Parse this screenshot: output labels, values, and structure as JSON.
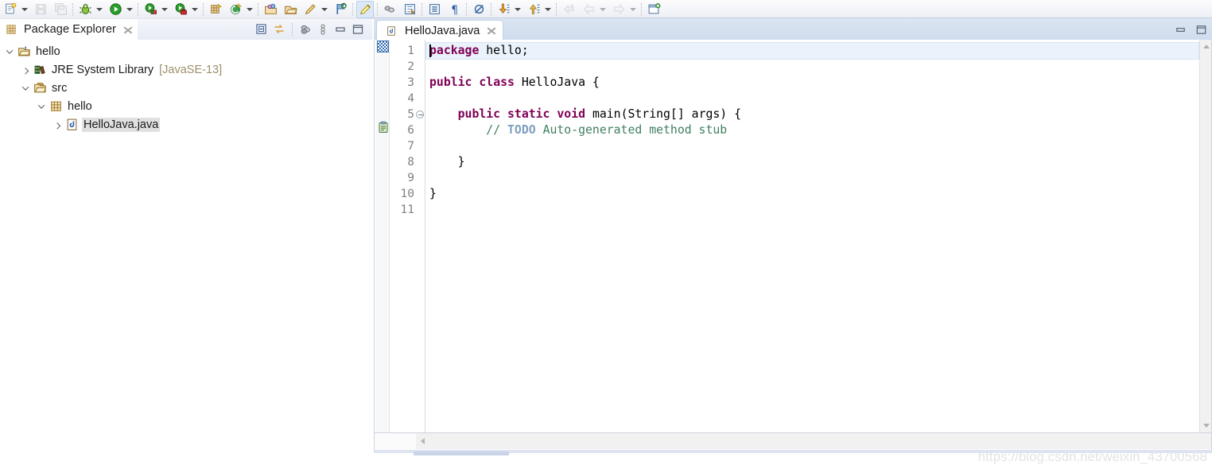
{
  "toolbar": {
    "items": [
      {
        "name": "new-wizard-button",
        "icon": "new-file-icon",
        "dropdown": true,
        "disabled": false
      },
      {
        "name": "save-button",
        "icon": "save-icon",
        "dropdown": false,
        "disabled": true
      },
      {
        "name": "save-all-button",
        "icon": "save-all-icon",
        "dropdown": false,
        "disabled": true
      },
      {
        "name": "debug-button",
        "icon": "debug-bug-icon",
        "dropdown": true,
        "disabled": false
      },
      {
        "name": "run-button",
        "icon": "run-play-icon",
        "dropdown": true,
        "disabled": false
      },
      {
        "name": "coverage-button",
        "icon": "coverage-icon",
        "dropdown": true,
        "disabled": false
      },
      {
        "name": "external-tools-button",
        "icon": "external-tools-icon",
        "dropdown": true,
        "disabled": false
      },
      {
        "name": "new-java-package-button",
        "icon": "new-package-icon",
        "dropdown": false,
        "disabled": false
      },
      {
        "name": "new-java-class-button",
        "icon": "new-class-icon",
        "dropdown": true,
        "disabled": false
      },
      {
        "name": "open-type-button",
        "icon": "open-type-icon",
        "dropdown": false,
        "disabled": false
      },
      {
        "name": "open-task-button",
        "icon": "open-folder-icon",
        "dropdown": false,
        "disabled": false
      },
      {
        "name": "edit-mode-button",
        "icon": "pencil-icon",
        "dropdown": true,
        "disabled": false
      },
      {
        "name": "search-button",
        "icon": "search-flag-icon",
        "dropdown": false,
        "disabled": false
      },
      {
        "name": "highlight-button",
        "icon": "highlight-icon",
        "dropdown": false,
        "disabled": false,
        "pressed": true
      },
      {
        "name": "link-button",
        "icon": "link-chain-icon",
        "dropdown": false,
        "disabled": false
      },
      {
        "name": "toggle-block-button",
        "icon": "block-selection-icon",
        "dropdown": false,
        "disabled": false
      },
      {
        "name": "show-whitespace-button",
        "icon": "whitespace-icon",
        "dropdown": false,
        "disabled": false
      },
      {
        "name": "pilcrow-button",
        "icon": "pilcrow-icon",
        "dropdown": false,
        "disabled": false
      },
      {
        "name": "skip-breakpoints-button",
        "icon": "skip-breakpoints-icon",
        "dropdown": false,
        "disabled": false
      },
      {
        "name": "next-annotation-button",
        "icon": "arrow-down-marker-icon",
        "dropdown": true,
        "disabled": false
      },
      {
        "name": "previous-annotation-button",
        "icon": "arrow-up-marker-icon",
        "dropdown": true,
        "disabled": false
      },
      {
        "name": "last-edit-location-button",
        "icon": "back-to-edit-icon",
        "dropdown": false,
        "disabled": true
      },
      {
        "name": "back-button",
        "icon": "arrow-left-icon",
        "dropdown": true,
        "disabled": true
      },
      {
        "name": "forward-button",
        "icon": "arrow-right-icon",
        "dropdown": true,
        "disabled": true
      },
      {
        "name": "new-window-button",
        "icon": "new-window-icon",
        "dropdown": false,
        "disabled": false
      }
    ]
  },
  "explorer": {
    "tab_title": "Package Explorer",
    "tab_icon": "package-explorer-icon",
    "close_icon": "close-icon",
    "toolbar": [
      {
        "name": "collapse-all-button",
        "icon": "collapse-all-icon"
      },
      {
        "name": "link-with-editor-button",
        "icon": "link-with-editor-icon"
      },
      {
        "name": "focus-on-active-button",
        "icon": "focus-active-task-icon"
      },
      {
        "name": "view-menu-button",
        "icon": "view-menu-icon"
      },
      {
        "name": "minimize-button",
        "icon": "minimize-icon"
      },
      {
        "name": "maximize-button",
        "icon": "maximize-icon"
      }
    ],
    "tree": [
      {
        "label": "hello",
        "suffix": "",
        "icon": "java-project-icon",
        "indent": 0,
        "twisty": "open",
        "selected": false
      },
      {
        "label": "JRE System Library",
        "suffix": "[JavaSE-13]",
        "icon": "library-icon",
        "indent": 1,
        "twisty": "closed",
        "selected": false
      },
      {
        "label": "src",
        "suffix": "",
        "icon": "source-folder-icon",
        "indent": 1,
        "twisty": "open",
        "selected": false
      },
      {
        "label": "hello",
        "suffix": "",
        "icon": "package-icon",
        "indent": 2,
        "twisty": "open",
        "selected": false
      },
      {
        "label": "HelloJava.java",
        "suffix": "",
        "icon": "java-file-icon",
        "indent": 3,
        "twisty": "closed",
        "selected": true
      }
    ]
  },
  "editor": {
    "tab_title": "HelloJava.java",
    "tab_icon": "java-file-icon",
    "close_icon": "close-icon",
    "window_buttons": [
      {
        "name": "minimize-button",
        "icon": "minimize-icon"
      },
      {
        "name": "maximize-button",
        "icon": "maximize-icon"
      }
    ],
    "markers": {
      "overview_ruler_icon": "changed-lines-marker",
      "todo_marker_icon": "todo-task-icon",
      "todo_marker_line": 6
    },
    "line_numbers": [
      1,
      2,
      3,
      4,
      5,
      6,
      7,
      8,
      9,
      10,
      11
    ],
    "fold_markers": [
      5
    ],
    "current_line": 1,
    "lines": [
      {
        "n": 1,
        "tokens": [
          {
            "t": "package",
            "c": "kw"
          },
          {
            "t": " hello;",
            "c": ""
          }
        ]
      },
      {
        "n": 2,
        "tokens": []
      },
      {
        "n": 3,
        "tokens": [
          {
            "t": "public",
            "c": "kw"
          },
          {
            "t": " ",
            "c": ""
          },
          {
            "t": "class",
            "c": "kw"
          },
          {
            "t": " HelloJava {",
            "c": ""
          }
        ]
      },
      {
        "n": 4,
        "tokens": []
      },
      {
        "n": 5,
        "tokens": [
          {
            "t": "    ",
            "c": ""
          },
          {
            "t": "public",
            "c": "kw"
          },
          {
            "t": " ",
            "c": ""
          },
          {
            "t": "static",
            "c": "kw"
          },
          {
            "t": " ",
            "c": ""
          },
          {
            "t": "void",
            "c": "kw"
          },
          {
            "t": " main(String[] args) {",
            "c": ""
          }
        ]
      },
      {
        "n": 6,
        "tokens": [
          {
            "t": "        ",
            "c": ""
          },
          {
            "t": "// ",
            "c": "cmt"
          },
          {
            "t": "TODO",
            "c": "todo"
          },
          {
            "t": " Auto-generated method stub",
            "c": "cmt"
          }
        ]
      },
      {
        "n": 7,
        "tokens": []
      },
      {
        "n": 8,
        "tokens": [
          {
            "t": "    }",
            "c": ""
          }
        ]
      },
      {
        "n": 9,
        "tokens": []
      },
      {
        "n": 10,
        "tokens": [
          {
            "t": "}",
            "c": ""
          }
        ]
      },
      {
        "n": 11,
        "tokens": []
      }
    ],
    "vscrollbar": {
      "up_icon": "chevron-up-icon",
      "down_icon": "chevron-down-icon"
    },
    "hscrollbar": {
      "left_icon": "chevron-left-icon"
    }
  },
  "watermark": "https://blog.csdn.net/weixin_43700568",
  "colors": {
    "keyword": "#7f0055",
    "comment": "#3f7f5f",
    "todo_tag": "#7f9fbf",
    "current_line_bg": "#eaf2fb",
    "selection_bg": "#e0e0e0",
    "tab_active_bg": "#ffffff",
    "toolbar_bg": "#f3f4f8",
    "library_suffix": "#9b8f6b"
  }
}
